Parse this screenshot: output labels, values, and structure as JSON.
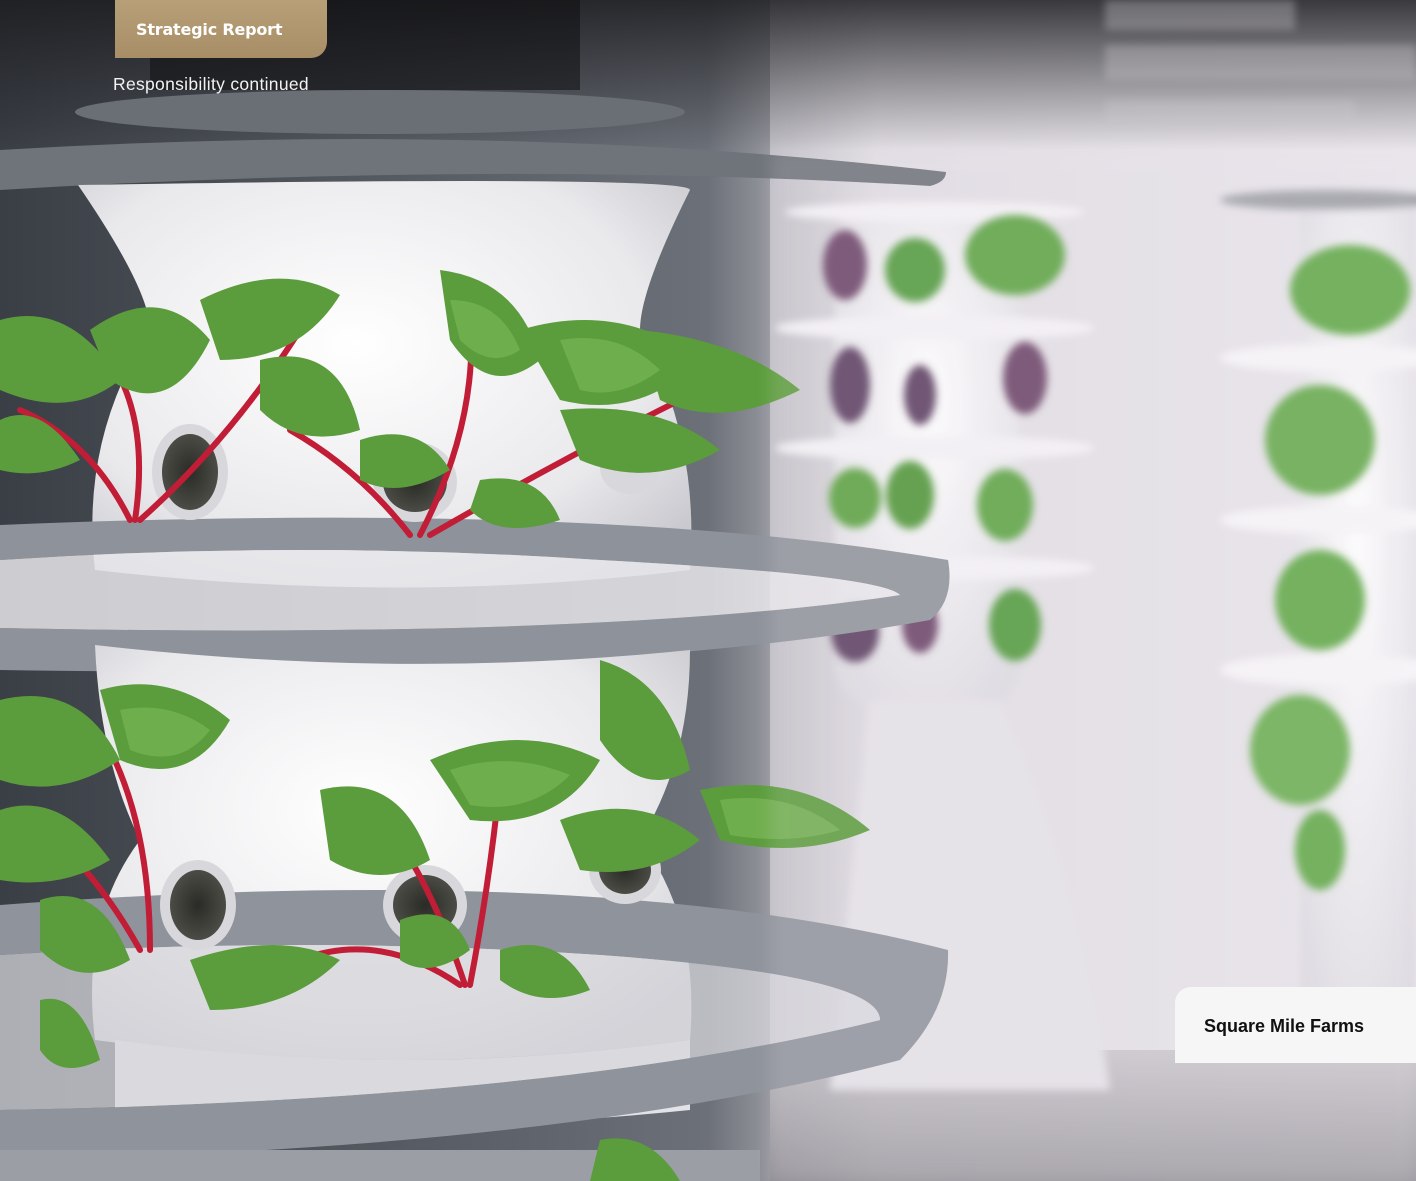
{
  "header": {
    "section_label": "Strategic Report",
    "subtitle": "Responsibility continued"
  },
  "photo": {
    "icon": "vertical-hydroponic-towers-image",
    "caption": "Square Mile Farms"
  },
  "colors": {
    "section_tab": "#b0966f",
    "caption_background": "#f6f6f6",
    "caption_text": "#111111",
    "subtitle_text": "#f2f2f2"
  }
}
